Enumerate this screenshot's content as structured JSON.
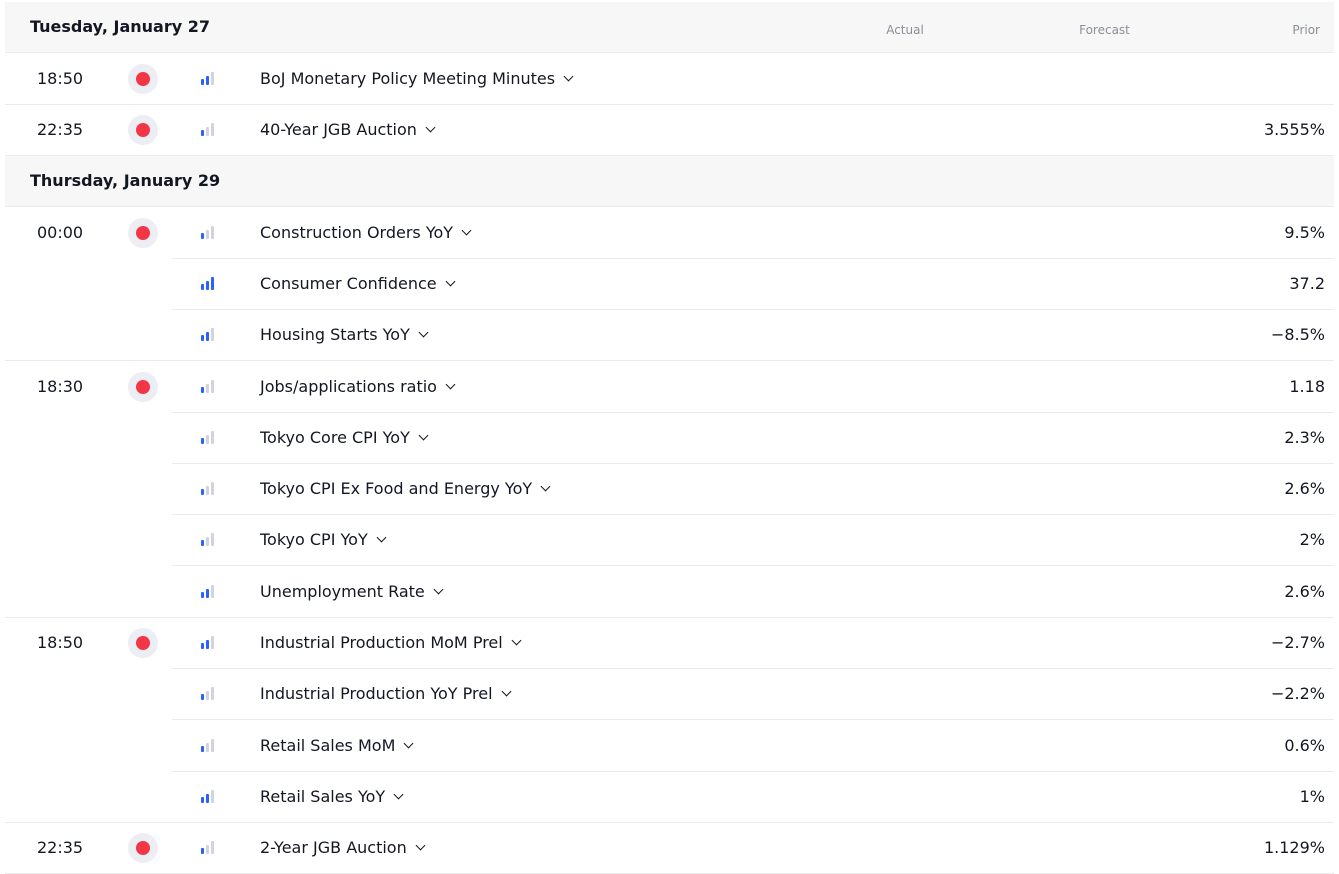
{
  "columns": {
    "actual": "Actual",
    "forecast": "Forecast",
    "prior": "Prior"
  },
  "days": [
    {
      "label": "Tuesday, January 27",
      "events": [
        {
          "time": "18:50",
          "title": "BoJ Monetary Policy Meeting Minutes",
          "prior": "",
          "importance": 2
        },
        {
          "time": "22:35",
          "title": "40-Year JGB Auction",
          "prior": "3.555%",
          "importance": 1
        }
      ]
    },
    {
      "label": "Thursday, January 29",
      "events": [
        {
          "time": "00:00",
          "title": "Construction Orders YoY",
          "prior": "9.5%",
          "importance": 1
        },
        {
          "time": "",
          "title": "Consumer Confidence",
          "prior": "37.2",
          "importance": 3
        },
        {
          "time": "",
          "title": "Housing Starts YoY",
          "prior": "−8.5%",
          "importance": 2
        },
        {
          "time": "18:30",
          "title": "Jobs/applications ratio",
          "prior": "1.18",
          "importance": 1
        },
        {
          "time": "",
          "title": "Tokyo Core CPI YoY",
          "prior": "2.3%",
          "importance": 1
        },
        {
          "time": "",
          "title": "Tokyo CPI Ex Food and Energy YoY",
          "prior": "2.6%",
          "importance": 1
        },
        {
          "time": "",
          "title": "Tokyo CPI YoY",
          "prior": "2%",
          "importance": 1
        },
        {
          "time": "",
          "title": "Unemployment Rate",
          "prior": "2.6%",
          "importance": 2
        },
        {
          "time": "18:50",
          "title": "Industrial Production MoM Prel",
          "prior": "−2.7%",
          "importance": 2
        },
        {
          "time": "",
          "title": "Industrial Production YoY Prel",
          "prior": "−2.2%",
          "importance": 1
        },
        {
          "time": "",
          "title": "Retail Sales MoM",
          "prior": "0.6%",
          "importance": 1
        },
        {
          "time": "",
          "title": "Retail Sales YoY",
          "prior": "1%",
          "importance": 2
        },
        {
          "time": "22:35",
          "title": "2-Year JGB Auction",
          "prior": "1.129%",
          "importance": 1
        }
      ]
    }
  ],
  "icons": {
    "country": "japan-flag-icon",
    "importance": "importance-bars-icon",
    "expand": "chevron-down-icon"
  },
  "colors": {
    "flag_dot": "#f23645",
    "importance_on": "#2962ff",
    "importance_off": "#d1d4dc"
  }
}
